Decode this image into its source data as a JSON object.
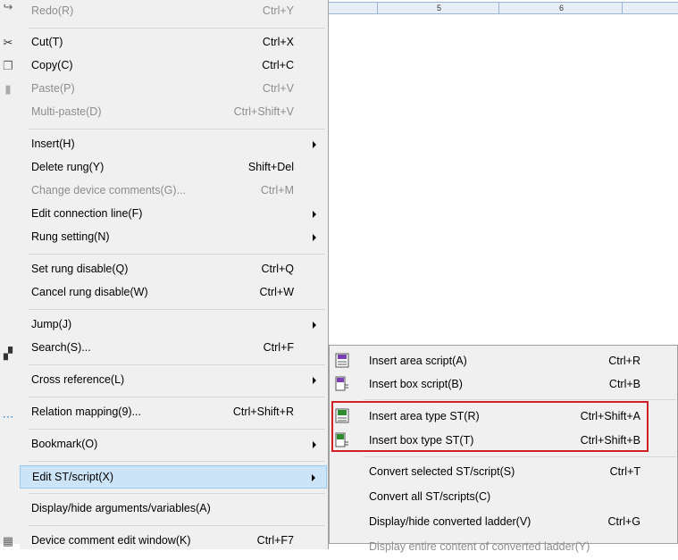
{
  "ruler": {
    "labels": [
      "5",
      "6"
    ]
  },
  "menu": {
    "items": [
      {
        "label": "Redo(R)",
        "shortcut": "Ctrl+Y",
        "disabled": true
      },
      {
        "label": "Cut(T)",
        "shortcut": "Ctrl+X"
      },
      {
        "label": "Copy(C)",
        "shortcut": "Ctrl+C"
      },
      {
        "label": "Paste(P)",
        "shortcut": "Ctrl+V",
        "disabled": true
      },
      {
        "label": "Multi-paste(D)",
        "shortcut": "Ctrl+Shift+V",
        "disabled": true
      },
      {
        "label": "Insert(H)",
        "shortcut": ""
      },
      {
        "label": "Delete rung(Y)",
        "shortcut": "Shift+Del"
      },
      {
        "label": "Change device comments(G)...",
        "shortcut": "Ctrl+M",
        "disabled": true
      },
      {
        "label": "Edit connection line(F)",
        "shortcut": ""
      },
      {
        "label": "Rung setting(N)",
        "shortcut": ""
      },
      {
        "label": "Set rung disable(Q)",
        "shortcut": "Ctrl+Q"
      },
      {
        "label": "Cancel rung disable(W)",
        "shortcut": "Ctrl+W"
      },
      {
        "label": "Jump(J)",
        "shortcut": ""
      },
      {
        "label": "Search(S)...",
        "shortcut": "Ctrl+F"
      },
      {
        "label": "Cross reference(L)",
        "shortcut": ""
      },
      {
        "label": "Relation mapping(9)...",
        "shortcut": "Ctrl+Shift+R"
      },
      {
        "label": "Bookmark(O)",
        "shortcut": ""
      },
      {
        "label": "Edit ST/script(X)",
        "shortcut": "",
        "highlighted": true
      },
      {
        "label": "Display/hide arguments/variables(A)",
        "shortcut": ""
      },
      {
        "label": "Device comment edit window(K)",
        "shortcut": "Ctrl+F7"
      }
    ]
  },
  "submenu": {
    "items": [
      {
        "label": "Insert area script(A)",
        "shortcut": "Ctrl+R",
        "icon": "area-script-icon"
      },
      {
        "label": "Insert box script(B)",
        "shortcut": "Ctrl+B",
        "icon": "box-script-icon"
      },
      {
        "label": "Insert area type ST(R)",
        "shortcut": "Ctrl+Shift+A",
        "icon": "area-st-icon"
      },
      {
        "label": "Insert box type ST(T)",
        "shortcut": "Ctrl+Shift+B",
        "icon": "box-st-icon"
      },
      {
        "label": "Convert selected ST/script(S)",
        "shortcut": "Ctrl+T"
      },
      {
        "label": "Convert all ST/scripts(C)",
        "shortcut": ""
      },
      {
        "label": "Display/hide converted ladder(V)",
        "shortcut": "Ctrl+G"
      },
      {
        "label": "Display entire content of converted ladder(Y)",
        "shortcut": ""
      }
    ]
  },
  "colors": {
    "highlight": "#cce4f7",
    "redbox": "#d0202a",
    "st_icon": "#2e8b2e",
    "script_icon": "#7a3fb0"
  }
}
